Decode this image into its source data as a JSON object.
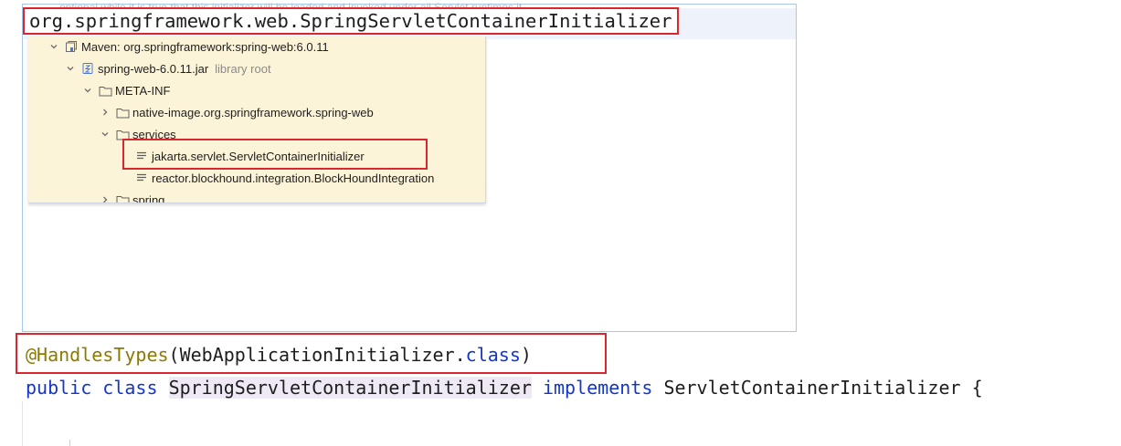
{
  "popup": {
    "faded_comment": "optional while it is true that this initializer will be loaded and invoked under all Servlet runtimes it",
    "class_fqn": "org.springframework.web.SpringServletContainerInitializer"
  },
  "tree": {
    "rows": [
      {
        "label": "Maven: org.springframework:spring-web:6.0.11",
        "icon": "library-icon",
        "expanded": true
      },
      {
        "label": "spring-web-6.0.11.jar",
        "suffix": "library root",
        "icon": "jar-icon",
        "expanded": true
      },
      {
        "label": "META-INF",
        "icon": "folder-icon",
        "expanded": true
      },
      {
        "label": "native-image.org.springframework.spring-web",
        "icon": "folder-icon",
        "expanded": false
      },
      {
        "label": "services",
        "icon": "folder-icon",
        "expanded": true
      },
      {
        "label": "jakarta.servlet.ServletContainerInitializer",
        "icon": "text-file-icon"
      },
      {
        "label": "reactor.blockhound.integration.BlockHoundIntegration",
        "icon": "text-file-icon"
      },
      {
        "label": "spring",
        "icon": "folder-icon",
        "expanded": false
      }
    ]
  },
  "code": {
    "annotation": "@HandlesTypes",
    "open_paren": "(",
    "annotation_arg": "WebApplicationInitializer",
    "dot": ".",
    "class_kw": "class",
    "close_paren": ")",
    "public_kw": "public",
    "class_decl_kw": "class",
    "class_name": "SpringServletContainerInitializer",
    "implements_kw": "implements",
    "interface_name": "ServletContainerInitializer",
    "brace": "{"
  },
  "colors": {
    "highlight_red": "#d9262f",
    "keyword_blue": "#1436c8",
    "annotation_olive": "#8c7a00",
    "tree_background": "#fcf4d8"
  }
}
